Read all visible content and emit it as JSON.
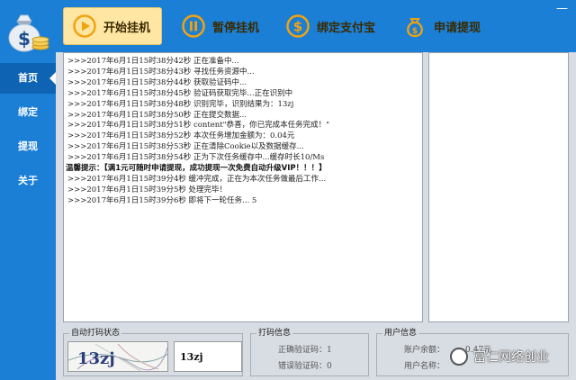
{
  "nav": {
    "items": [
      {
        "label": "首页",
        "active": true
      },
      {
        "label": "绑定",
        "active": false
      },
      {
        "label": "提现",
        "active": false
      },
      {
        "label": "关于",
        "active": false
      }
    ]
  },
  "toolbar": {
    "start_label": "开始挂机",
    "pause_label": "暂停挂机",
    "bind_label": "绑定支付宝",
    "withdraw_label": "申请提现",
    "minimize_label": "—"
  },
  "log": {
    "lines": [
      ">>>2017年6月1日15时38分42秒  正在准备中...",
      ">>>2017年6月1日15时38分43秒  寻找任务资源中...",
      ">>>2017年6月1日15时38分44秒  获取验证码中...",
      ">>>2017年6月1日15时38分45秒  验证码获取完毕...正在识别中",
      ">>>2017年6月1日15时38分48秒  识别完毕，识别结果为：13zj",
      ">>>2017年6月1日15时38分50秒  正在提交数据...",
      ">>>2017年6月1日15时38分51秒  content\"恭喜，你已完成本任务完成！\"",
      ">>>2017年6月1日15时38分52秒  本次任务增加金额为：0.04元",
      ">>>2017年6月1日15时38分53秒  正在清除Cookie以及数据缓存...",
      ">>>2017年6月1日15时38分54秒  正为下次任务缓存中...缓存时长10/Ms",
      "温馨提示：【满1元可随时申请提现，成功提现一次免费自动升级VIP！！！】",
      ">>>2017年6月1日15时39分4秒  缓冲完成，正在为本次任务做最后工作...",
      ">>>2017年6月1日15时39分5秒  处理完毕！",
      ">>>2017年6月1日15时39分6秒  即将下一轮任务... 5"
    ]
  },
  "captcha": {
    "title": "自动打码状态",
    "image_text": "13zj",
    "result": "13zj"
  },
  "code_info": {
    "title": "打码信息",
    "correct_label": "正确验证码：1",
    "wrong_label": "错误验证码：0"
  },
  "user_info": {
    "title": "用户信息",
    "balance_label": "账户余额：",
    "balance_value": "0.47元",
    "name_label": "用户名称："
  },
  "watermark": {
    "text": "富仁网络创业"
  },
  "colors": {
    "primary": "#1b7fd6",
    "nav_active": "#0f63b3",
    "button_active": "#ffe7a3",
    "icon_orange": "#f2a20f",
    "content_bg": "#d8dde4"
  }
}
